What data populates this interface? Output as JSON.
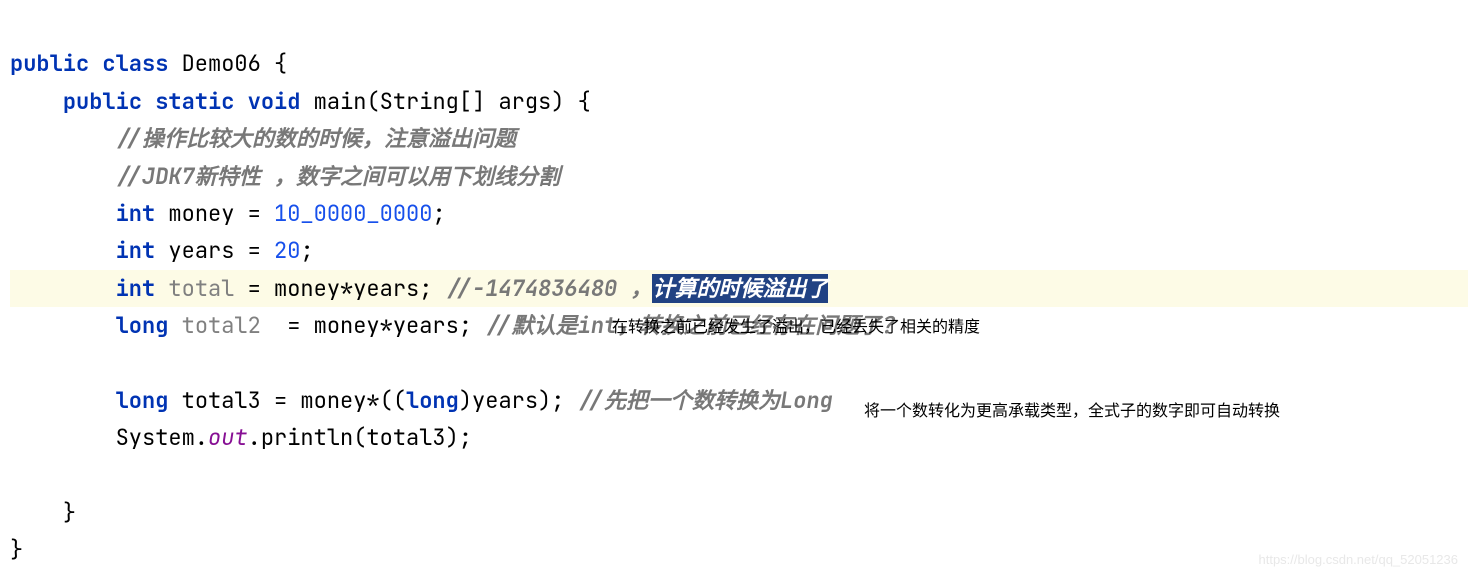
{
  "code": {
    "l1": {
      "kw1": "public class",
      "cls": "Demo06",
      "brace": " {"
    },
    "l2": {
      "kw1": "public static void",
      "m": " main",
      "p": "(String[] args) {"
    },
    "l3": {
      "c": "//操作比较大的数的时候，注意溢出问题"
    },
    "l4": {
      "c": "//JDK7新特性 ，数字之间可以用下划线分割"
    },
    "l5": {
      "kw": "int",
      "n": " money = ",
      "num": "10_0000_0000",
      "semi": ";"
    },
    "l6": {
      "kw": "int",
      "n": " years = ",
      "num": "20",
      "semi": ";"
    },
    "l7": {
      "kw": "int",
      "var": " total",
      "expr": " = money*years; ",
      "c1": "//-1474836480 ，",
      "sel": "计算的时候溢出了"
    },
    "l8": {
      "kw": "long",
      "var": " total2",
      "expr": "  = money*years; ",
      "c": "//默认是int，转换之前已经存在问题了？"
    },
    "l9": {
      "kw": "long",
      "n": " total3 = money*((",
      "kw2": "long",
      "rest": ")years); ",
      "c": "//先把一个数转换为Long"
    },
    "l10": {
      "pre": "System.",
      "out": "out",
      "rest": ".println(total3);"
    },
    "l11": {
      "brace": "}"
    },
    "l12": {
      "brace": "}"
    }
  },
  "annotations": {
    "a1": "在转换之前已经发生了溢出，已经丢失了相关的精度",
    "a2": "将一个数转化为更高承载类型，全式子的数字即可自动转换"
  },
  "watermark": "https://blog.csdn.net/qq_52051236"
}
